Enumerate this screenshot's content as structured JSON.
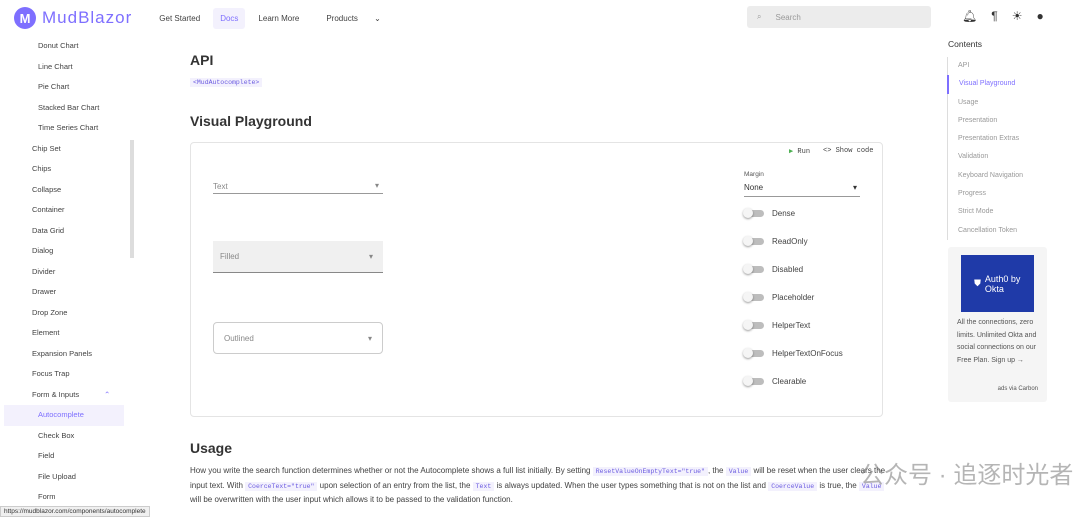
{
  "header": {
    "brand": "MudBlazor",
    "nav": [
      "Get Started",
      "Docs",
      "Learn More",
      "Products"
    ],
    "search_placeholder": "Search"
  },
  "sidebar": {
    "items": [
      "Donut Chart",
      "Line Chart",
      "Pie Chart",
      "Stacked Bar Chart",
      "Time Series Chart",
      "Chip Set",
      "Chips",
      "Collapse",
      "Container",
      "Data Grid",
      "Dialog",
      "Divider",
      "Drawer",
      "Drop Zone",
      "Element",
      "Expansion Panels",
      "Focus Trap",
      "Form & Inputs",
      "Autocomplete",
      "Check Box",
      "Field",
      "File Upload",
      "Form"
    ]
  },
  "main": {
    "api_title": "API",
    "api_tag": "<MudAutocomplete>",
    "playground_title": "Visual Playground",
    "run": "Run",
    "show_code": "Show code",
    "fields": {
      "text": "Text",
      "filled": "Filled",
      "outlined": "Outlined"
    },
    "margin_label": "Margin",
    "margin_value": "None",
    "switches": [
      "Dense",
      "ReadOnly",
      "Disabled",
      "Placeholder",
      "HelperText",
      "HelperTextOnFocus",
      "Clearable"
    ],
    "usage_title": "Usage",
    "usage": {
      "t1": "How you write the search function determines whether or not the Autocomplete shows a full list initially. By setting ",
      "c1": "ResetValueOnEmptyText=\"true\"",
      "t2": ", the ",
      "c2": "Value",
      "t3": " will be reset when the user clears the input text. With ",
      "c3": "CoerceText=\"true\"",
      "t4": " upon selection of an entry from the list, the ",
      "c4": "Text",
      "t5": " is always updated. When the user types something that is not on the list and ",
      "c5": "CoerceValue",
      "t6": " is true, the ",
      "c6": "Value",
      "t7": " will be overwritten with the user input which allows it to be passed to the validation function."
    }
  },
  "toc": {
    "title": "Contents",
    "items": [
      "API",
      "Visual Playground",
      "Usage",
      "Presentation",
      "Presentation Extras",
      "Validation",
      "Keyboard Navigation",
      "Progress",
      "Strict Mode",
      "Cancellation Token"
    ]
  },
  "ad": {
    "logo": "Auth0 by Okta",
    "text": "All the connections, zero limits. Unlimited Okta and social connections on our Free Plan. Sign up →",
    "via": "ads via Carbon"
  },
  "status_url": "https://mudblazor.com/components/autocomplete",
  "watermark": "公众号 · 追逐时光者"
}
